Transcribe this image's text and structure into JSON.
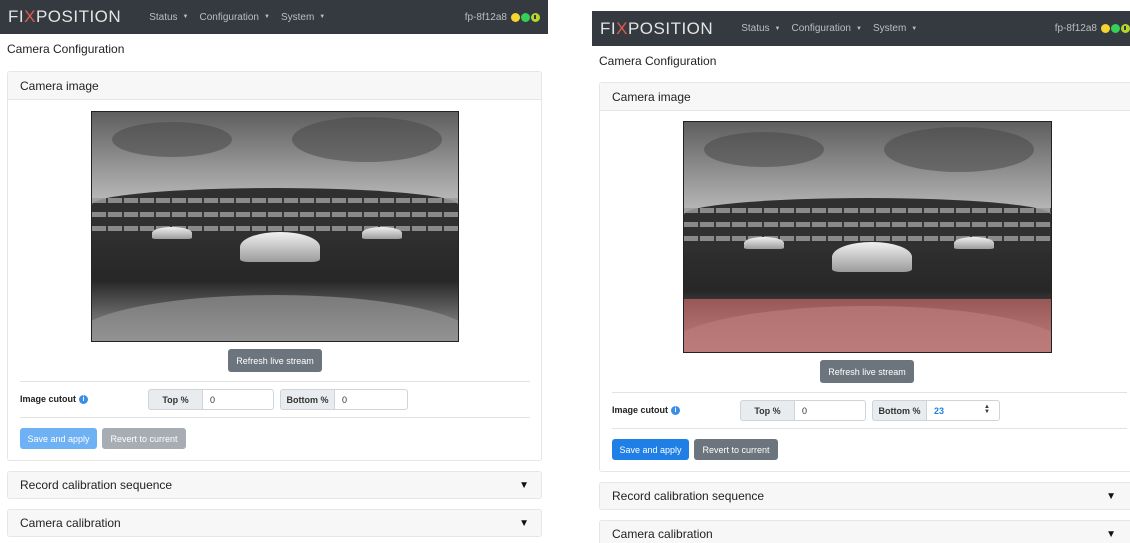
{
  "app": {
    "logo_prefix": "FI",
    "logo_x": "X",
    "logo_suffix": "POSITION",
    "nav": [
      {
        "label": "Status"
      },
      {
        "label": "Configuration"
      },
      {
        "label": "System"
      }
    ],
    "device_id": "fp-8f12a8",
    "status_colors": {
      "yellow": "#f5d331",
      "green": "#34d05a",
      "power": "#b7d62a"
    }
  },
  "page": {
    "title": "Camera Configuration"
  },
  "camera_card": {
    "header": "Camera image",
    "refresh_label": "Refresh live stream",
    "cutout_label": "Image cutout",
    "top_label": "Top %",
    "bottom_label": "Bottom %",
    "save_label": "Save and apply",
    "revert_label": "Revert to current"
  },
  "left_state": {
    "top_value": "0",
    "bottom_value": "0"
  },
  "right_state": {
    "top_value": "0",
    "bottom_value": "23",
    "cutout_bottom_fraction": 0.23
  },
  "collapsed_cards": [
    {
      "label": "Record calibration sequence",
      "icon": "triangle-down"
    },
    {
      "label": "Camera calibration",
      "icon": "triangle-down"
    }
  ],
  "colors": {
    "navbar": "#343a40",
    "primary": "#1f7fe6",
    "secondary": "#6c757d",
    "cutout_overlay": "#d66e6e"
  }
}
